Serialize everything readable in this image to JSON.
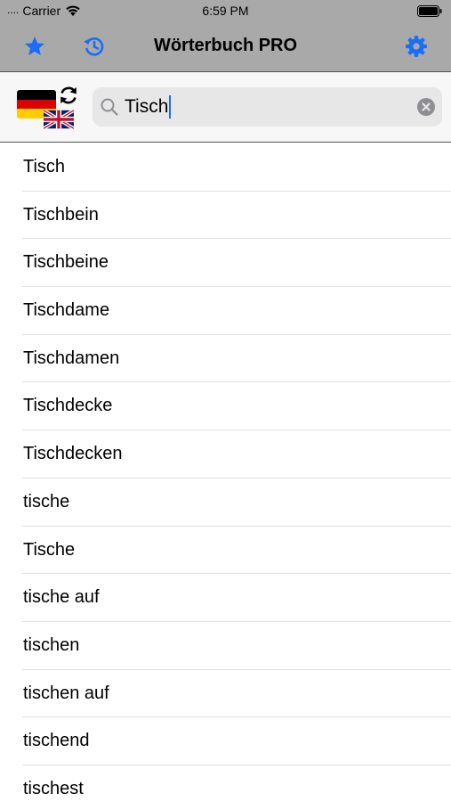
{
  "status_bar": {
    "signal": "....",
    "carrier": "Carrier",
    "time": "6:59 PM"
  },
  "nav": {
    "title": "Wörterbuch PRO",
    "icons": [
      "star-icon",
      "history-icon",
      "gear-icon"
    ],
    "accent_color": "#1a6ef5"
  },
  "search": {
    "query": "Tisch",
    "placeholder": "",
    "source_language_flag": "german-flag-icon",
    "target_language_flag": "uk-flag-icon"
  },
  "results": [
    "Tisch",
    "Tischbein",
    "Tischbeine",
    "Tischdame",
    "Tischdamen",
    "Tischdecke",
    "Tischdecken",
    "tische",
    "Tische",
    "tische auf",
    "tischen",
    "tischen auf",
    "tischend",
    "tischest"
  ]
}
